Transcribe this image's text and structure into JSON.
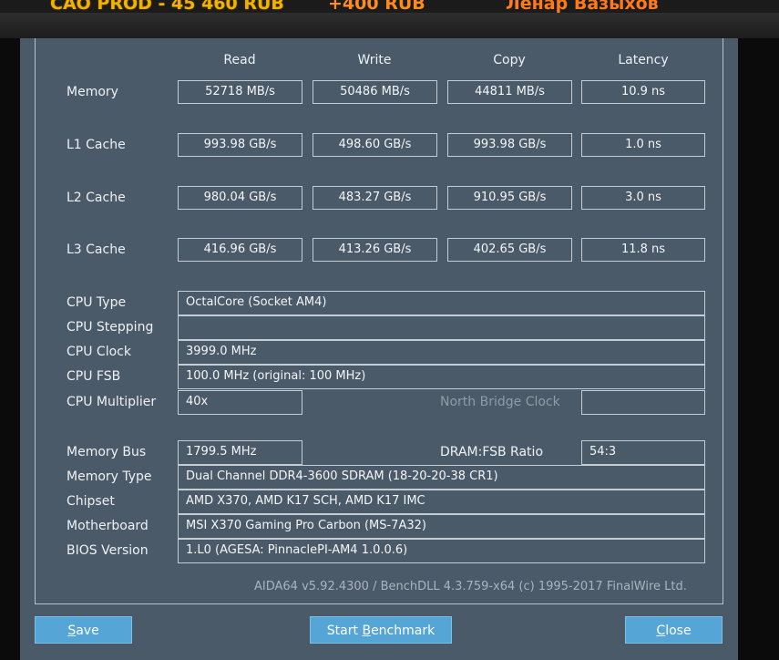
{
  "banner": {
    "left": "САО PROD - 45 460 RUB",
    "mid": "+400 RUB",
    "right": "Ленар Вазыхов"
  },
  "columns": [
    "Read",
    "Write",
    "Copy",
    "Latency"
  ],
  "bench_rows": [
    {
      "label": "Memory",
      "read": "52718 MB/s",
      "write": "50486 MB/s",
      "copy": "44811 MB/s",
      "latency": "10.9 ns"
    },
    {
      "label": "L1 Cache",
      "read": "993.98 GB/s",
      "write": "498.60 GB/s",
      "copy": "993.98 GB/s",
      "latency": "1.0 ns"
    },
    {
      "label": "L2 Cache",
      "read": "980.04 GB/s",
      "write": "483.27 GB/s",
      "copy": "910.95 GB/s",
      "latency": "3.0 ns"
    },
    {
      "label": "L3 Cache",
      "read": "416.96 GB/s",
      "write": "413.26 GB/s",
      "copy": "402.65 GB/s",
      "latency": "11.8 ns"
    }
  ],
  "cpu": {
    "type_label": "CPU Type",
    "type_value": "OctalCore   (Socket AM4)",
    "stepping_label": "CPU Stepping",
    "stepping_value": "",
    "clock_label": "CPU Clock",
    "clock_value": "3999.0 MHz",
    "fsb_label": "CPU FSB",
    "fsb_value": "100.0 MHz  (original: 100 MHz)",
    "multiplier_label": "CPU Multiplier",
    "multiplier_value": "40x",
    "nb_clock_label": "North Bridge Clock",
    "nb_clock_value": ""
  },
  "memory": {
    "bus_label": "Memory Bus",
    "bus_value": "1799.5 MHz",
    "ratio_label": "DRAM:FSB Ratio",
    "ratio_value": "54:3",
    "type_label": "Memory Type",
    "type_value": "Dual Channel DDR4-3600 SDRAM  (18-20-20-38 CR1)",
    "chipset_label": "Chipset",
    "chipset_value": "AMD X370, AMD K17 SCH, AMD K17 IMC",
    "motherboard_label": "Motherboard",
    "motherboard_value": "MSI X370 Gaming Pro Carbon (MS-7A32)",
    "bios_label": "BIOS Version",
    "bios_value": "1.L0  (AGESA: PinnaclePI-AM4 1.0.0.6)"
  },
  "footer": "AIDA64 v5.92.4300 / BenchDLL 4.3.759-x64  (c) 1995-2017 FinalWire Ltd.",
  "buttons": {
    "save_hot": "S",
    "save_rest": "ave",
    "start_pre": "Start ",
    "start_hot": "B",
    "start_rest": "enchmark",
    "close_hot": "C",
    "close_rest": "lose"
  }
}
